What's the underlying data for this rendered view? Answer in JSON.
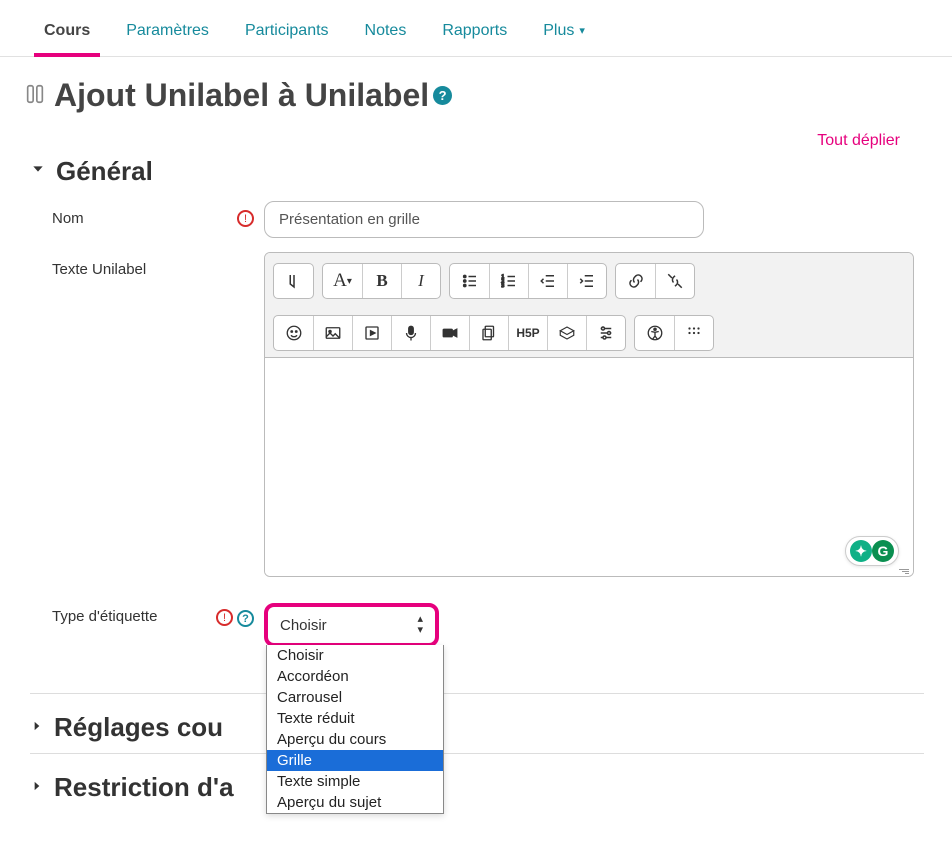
{
  "tabs": {
    "items": [
      "Cours",
      "Paramètres",
      "Participants",
      "Notes",
      "Rapports",
      "Plus"
    ],
    "active": "Cours"
  },
  "page": {
    "title": "Ajout Unilabel à Unilabel",
    "expand_all": "Tout déplier"
  },
  "sections": {
    "general": {
      "title": "Général",
      "expanded": true
    },
    "common": {
      "title": "Réglages cou",
      "expanded": false
    },
    "restrict": {
      "title": "Restriction d'a",
      "expanded": false
    }
  },
  "fields": {
    "name": {
      "label": "Nom",
      "value": "Présentation en grille",
      "required": true
    },
    "unilabel_text": {
      "label": "Texte Unilabel"
    },
    "label_type": {
      "label": "Type d'étiquette",
      "required": true,
      "selected": "Choisir",
      "options": [
        "Choisir",
        "Accordéon",
        "Carrousel",
        "Texte réduit",
        "Aperçu du cours",
        "Grille",
        "Texte simple",
        "Aperçu du sujet"
      ],
      "highlighted": "Grille"
    }
  },
  "editor": {
    "buttons_row1": [
      "toggle",
      "paragraph",
      "bold",
      "italic"
    ],
    "buttons_row1b": [
      "ulist",
      "olist",
      "indent",
      "outdent"
    ],
    "buttons_row1c": [
      "link",
      "unlink"
    ],
    "buttons_row2": [
      "emoji",
      "image",
      "media",
      "mic",
      "video",
      "files",
      "h5p",
      "box",
      "settings"
    ],
    "buttons_row2b": [
      "accessibility",
      "grid"
    ]
  }
}
